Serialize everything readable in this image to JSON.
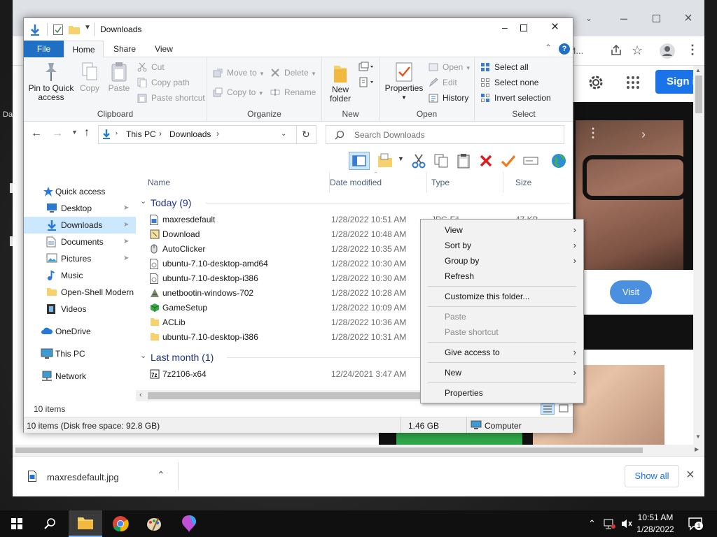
{
  "desktop": {
    "side_labels": [
      "Da"
    ]
  },
  "chrome": {
    "tab_text": "TfM...",
    "signin_label": "Sign i",
    "visit_label": "Visit",
    "download_file": "maxresdefault.jpg",
    "show_all_label": "Show all",
    "colors": {
      "accent": "#1a73e8",
      "visit_bg": "#4a8fe0"
    }
  },
  "explorer": {
    "title": "Downloads",
    "tabs": [
      "File",
      "Home",
      "Share",
      "View"
    ],
    "ribbon": {
      "clipboard": {
        "label": "Clipboard",
        "pin": "Pin to Quick access",
        "copy": "Copy",
        "paste": "Paste",
        "cut": "Cut",
        "copy_path": "Copy path",
        "paste_shortcut": "Paste shortcut"
      },
      "organize": {
        "label": "Organize",
        "move_to": "Move to",
        "copy_to": "Copy to",
        "delete": "Delete",
        "rename": "Rename"
      },
      "new": {
        "label": "New",
        "new_folder": "New folder"
      },
      "open": {
        "label": "Open",
        "properties": "Properties",
        "open": "Open",
        "edit": "Edit",
        "history": "History"
      },
      "select": {
        "label": "Select",
        "select_all": "Select all",
        "select_none": "Select none",
        "invert": "Invert selection"
      }
    },
    "address": {
      "crumbs": [
        "This PC",
        "Downloads"
      ]
    },
    "search_placeholder": "Search Downloads",
    "nav": [
      {
        "label": "Quick access"
      },
      {
        "label": "Desktop"
      },
      {
        "label": "Downloads"
      },
      {
        "label": "Documents"
      },
      {
        "label": "Pictures"
      },
      {
        "label": "Music"
      },
      {
        "label": "Open-Shell Modern"
      },
      {
        "label": "Videos"
      },
      {
        "label": "OneDrive"
      },
      {
        "label": "This PC"
      },
      {
        "label": "Network"
      }
    ],
    "columns": [
      "Name",
      "Date modified",
      "Type",
      "Size"
    ],
    "groups": [
      {
        "label": "Today (9)",
        "files": [
          {
            "name": "maxresdefault",
            "date": "1/28/2022 10:51 AM",
            "type": "JPG Fil",
            "size": "47 KB"
          },
          {
            "name": "Download",
            "date": "1/28/2022 10:48 AM",
            "type": "",
            "size": ""
          },
          {
            "name": "AutoClicker",
            "date": "1/28/2022 10:35 AM",
            "type": "",
            "size": ""
          },
          {
            "name": "ubuntu-7.10-desktop-amd64",
            "date": "1/28/2022 10:30 AM",
            "type": "",
            "size": ""
          },
          {
            "name": "ubuntu-7.10-desktop-i386",
            "date": "1/28/2022 10:30 AM",
            "type": "",
            "size": ""
          },
          {
            "name": "unetbootin-windows-702",
            "date": "1/28/2022 10:28 AM",
            "type": "",
            "size": ""
          },
          {
            "name": "GameSetup",
            "date": "1/28/2022 10:09 AM",
            "type": "",
            "size": ""
          },
          {
            "name": "ACLib",
            "date": "1/28/2022 10:36 AM",
            "type": "",
            "size": ""
          },
          {
            "name": "ubuntu-7.10-desktop-i386",
            "date": "1/28/2022 10:31 AM",
            "type": "",
            "size": ""
          }
        ]
      },
      {
        "label": "Last month (1)",
        "files": [
          {
            "name": "7z2106-x64",
            "date": "12/24/2021 3:47 AM",
            "type": "",
            "size": ""
          }
        ]
      }
    ],
    "items_count": "10 items",
    "status": {
      "left": "10 items (Disk free space: 92.8 GB)",
      "size": "1.46 GB",
      "location": "Computer"
    }
  },
  "context_menu": [
    {
      "label": "View",
      "submenu": true,
      "enabled": true
    },
    {
      "label": "Sort by",
      "submenu": true,
      "enabled": true
    },
    {
      "label": "Group by",
      "submenu": true,
      "enabled": true
    },
    {
      "label": "Refresh",
      "submenu": false,
      "enabled": true
    },
    {
      "label": "Customize this folder...",
      "submenu": false,
      "enabled": true
    },
    {
      "label": "Paste",
      "submenu": false,
      "enabled": false
    },
    {
      "label": "Paste shortcut",
      "submenu": false,
      "enabled": false
    },
    {
      "label": "Give access to",
      "submenu": true,
      "enabled": true
    },
    {
      "label": "New",
      "submenu": true,
      "enabled": true
    },
    {
      "label": "Properties",
      "submenu": false,
      "enabled": true
    }
  ],
  "taskbar": {
    "time": "10:51 AM",
    "date": "1/28/2022",
    "notification_count": "1"
  }
}
